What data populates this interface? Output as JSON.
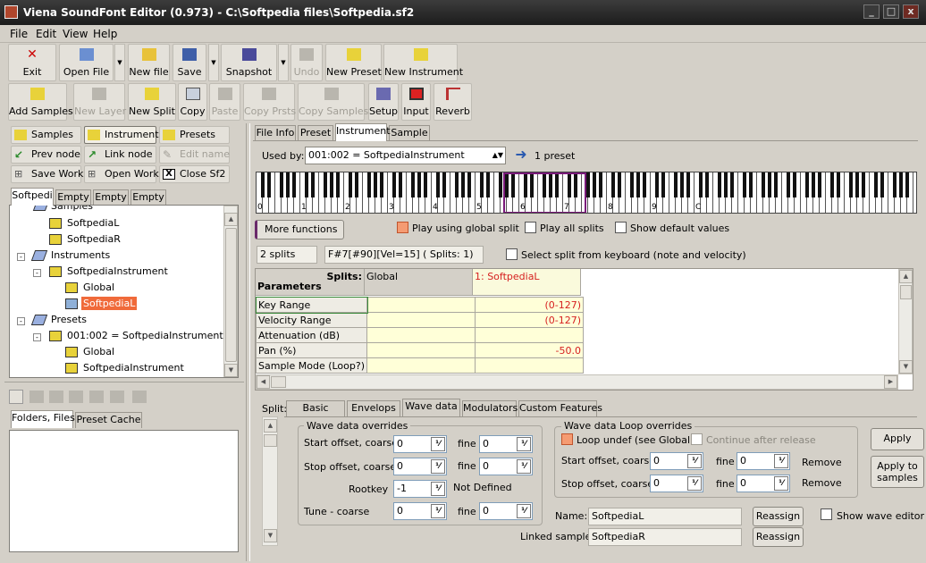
{
  "window": {
    "title": "Viena SoundFont Editor (0.973) - C:\\Softpedia files\\Softpedia.sf2",
    "min": "_",
    "max": "□",
    "close": "x"
  },
  "menu": [
    "File",
    "Edit",
    "View",
    "Help"
  ],
  "toolbar1": [
    "Exit",
    "Open File",
    "New file",
    "Save",
    "Snapshot",
    "Undo",
    "New Preset",
    "New Instrument"
  ],
  "toolbar2": [
    "Add Samples",
    "New Layer",
    "New Split",
    "Copy",
    "Paste",
    "Copy Prsts",
    "Copy Samples",
    "Setup",
    "Input",
    "Reverb"
  ],
  "nav": {
    "samples": "Samples",
    "instruments": "Instruments",
    "presets": "Presets",
    "prev_node": "Prev node",
    "link_node": "Link node",
    "edit_name": "Edit name",
    "save_work": "Save Work",
    "open_work": "Open Work",
    "close_sf2": "Close Sf2"
  },
  "file_tabs": [
    "Softpedi",
    "Empty",
    "Empty",
    "Empty"
  ],
  "tree": {
    "samples": "Samples",
    "sample1": "SoftpediaL",
    "sample2": "SoftpediaR",
    "instruments": "Instruments",
    "instrument": "SoftpediaInstrument",
    "global": "Global",
    "split": "SoftpediaL",
    "presets": "Presets",
    "preset": "001:002 = SoftpediaInstrument",
    "preset_global": "Global",
    "preset_instrument": "SoftpediaInstrument"
  },
  "bottom_tabs": [
    "Folders, Files",
    "Preset Cache"
  ],
  "main_tabs": [
    "File Info",
    "Preset",
    "Instrument",
    "Sample"
  ],
  "used_by": {
    "label": "Used by:",
    "value": "001:002 = SoftpediaInstrument",
    "count": "1 preset"
  },
  "keyboard_labels": [
    "0",
    "1",
    "2",
    "3",
    "4",
    "5",
    "6",
    "7",
    "8",
    "9",
    "C"
  ],
  "options": {
    "more_functions": "More functions ...",
    "play_global": "Play using global split",
    "play_all": "Play all splits",
    "show_defaults": "Show default values",
    "splits_count": "2 splits",
    "split_info": "F#7[#90][Vel=15] ( Splits: 1)",
    "select_split": "Select split from keyboard (note and velocity)"
  },
  "grid": {
    "splits_label": "Splits:",
    "params_label": "Parameters",
    "col_global": "Global",
    "col_split": "1: SoftpediaL",
    "rows": [
      {
        "name": "Key Range",
        "global": "",
        "split": "(0-127)"
      },
      {
        "name": "Velocity Range",
        "global": "",
        "split": "(0-127)"
      },
      {
        "name": "Attenuation (dB)",
        "global": "",
        "split": ""
      },
      {
        "name": "Pan (%)",
        "global": "",
        "split": "-50.0"
      },
      {
        "name": "Sample Mode (Loop?)",
        "global": "",
        "split": ""
      }
    ]
  },
  "split_label": "Split:",
  "split_tabs": [
    "Basic",
    "Envelops",
    "Wave data",
    "Modulators",
    "Custom Features"
  ],
  "wave": {
    "group": "Wave data overrides",
    "start_label": "Start offset, coarse",
    "stop_label": "Stop offset, coarse",
    "rootkey_label": "Rootkey",
    "tune_label": "Tune - coarse",
    "fine": "fine",
    "start": "0",
    "start_fine": "0",
    "stop": "0",
    "stop_fine": "0",
    "rootkey": "-1",
    "not_defined": "Not Defined",
    "tune": "0",
    "tune_fine": "0"
  },
  "loop": {
    "group": "Wave data Loop overrides",
    "loop_undef": "Loop undef (see Global)",
    "continue": "Continue after release",
    "start_label": "Start offset, coarse",
    "stop_label": "Stop offset, coarse",
    "fine": "fine",
    "start": "0",
    "start_fine": "0",
    "stop": "0",
    "stop_fine": "0",
    "remove": "Remove"
  },
  "actions": {
    "apply": "Apply",
    "apply_samples": "Apply to samples",
    "show_wave": "Show wave editor"
  },
  "name_label": "Name:",
  "name_value": "SoftpediaL",
  "linked_label": "Linked sample:",
  "linked_value": "SoftpediaR",
  "reassign": "Reassign"
}
